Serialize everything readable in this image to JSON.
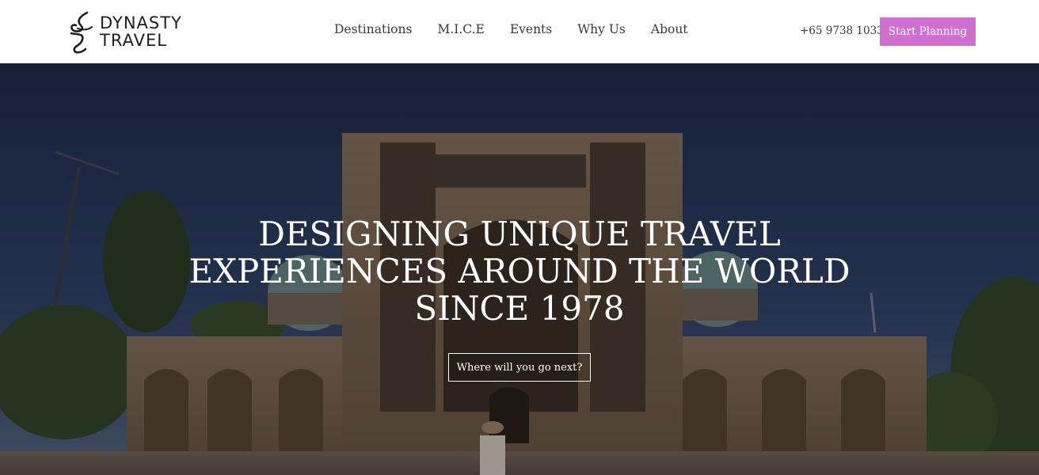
{
  "brand": {
    "line1": "DYNASTY",
    "line2": "TRAVEL"
  },
  "nav": {
    "items": [
      {
        "label": "Destinations"
      },
      {
        "label": "M.I.C.E"
      },
      {
        "label": "Events"
      },
      {
        "label": "Why Us"
      },
      {
        "label": "About"
      }
    ]
  },
  "header": {
    "phone": "+65 9738 1033",
    "cta_label": "Start Planning"
  },
  "hero": {
    "headline": [
      "DESIGNING UNIQUE TRAVEL",
      "EXPERIENCES AROUND THE WORLD",
      "SINCE 1978"
    ],
    "button_label": "Where will you go next?"
  },
  "colors": {
    "accent": "#cf6fd0",
    "text_dark": "#333a45",
    "hero_text": "#ffffff"
  },
  "icons": {
    "logo": "dynasty-dragon-logo-icon"
  }
}
